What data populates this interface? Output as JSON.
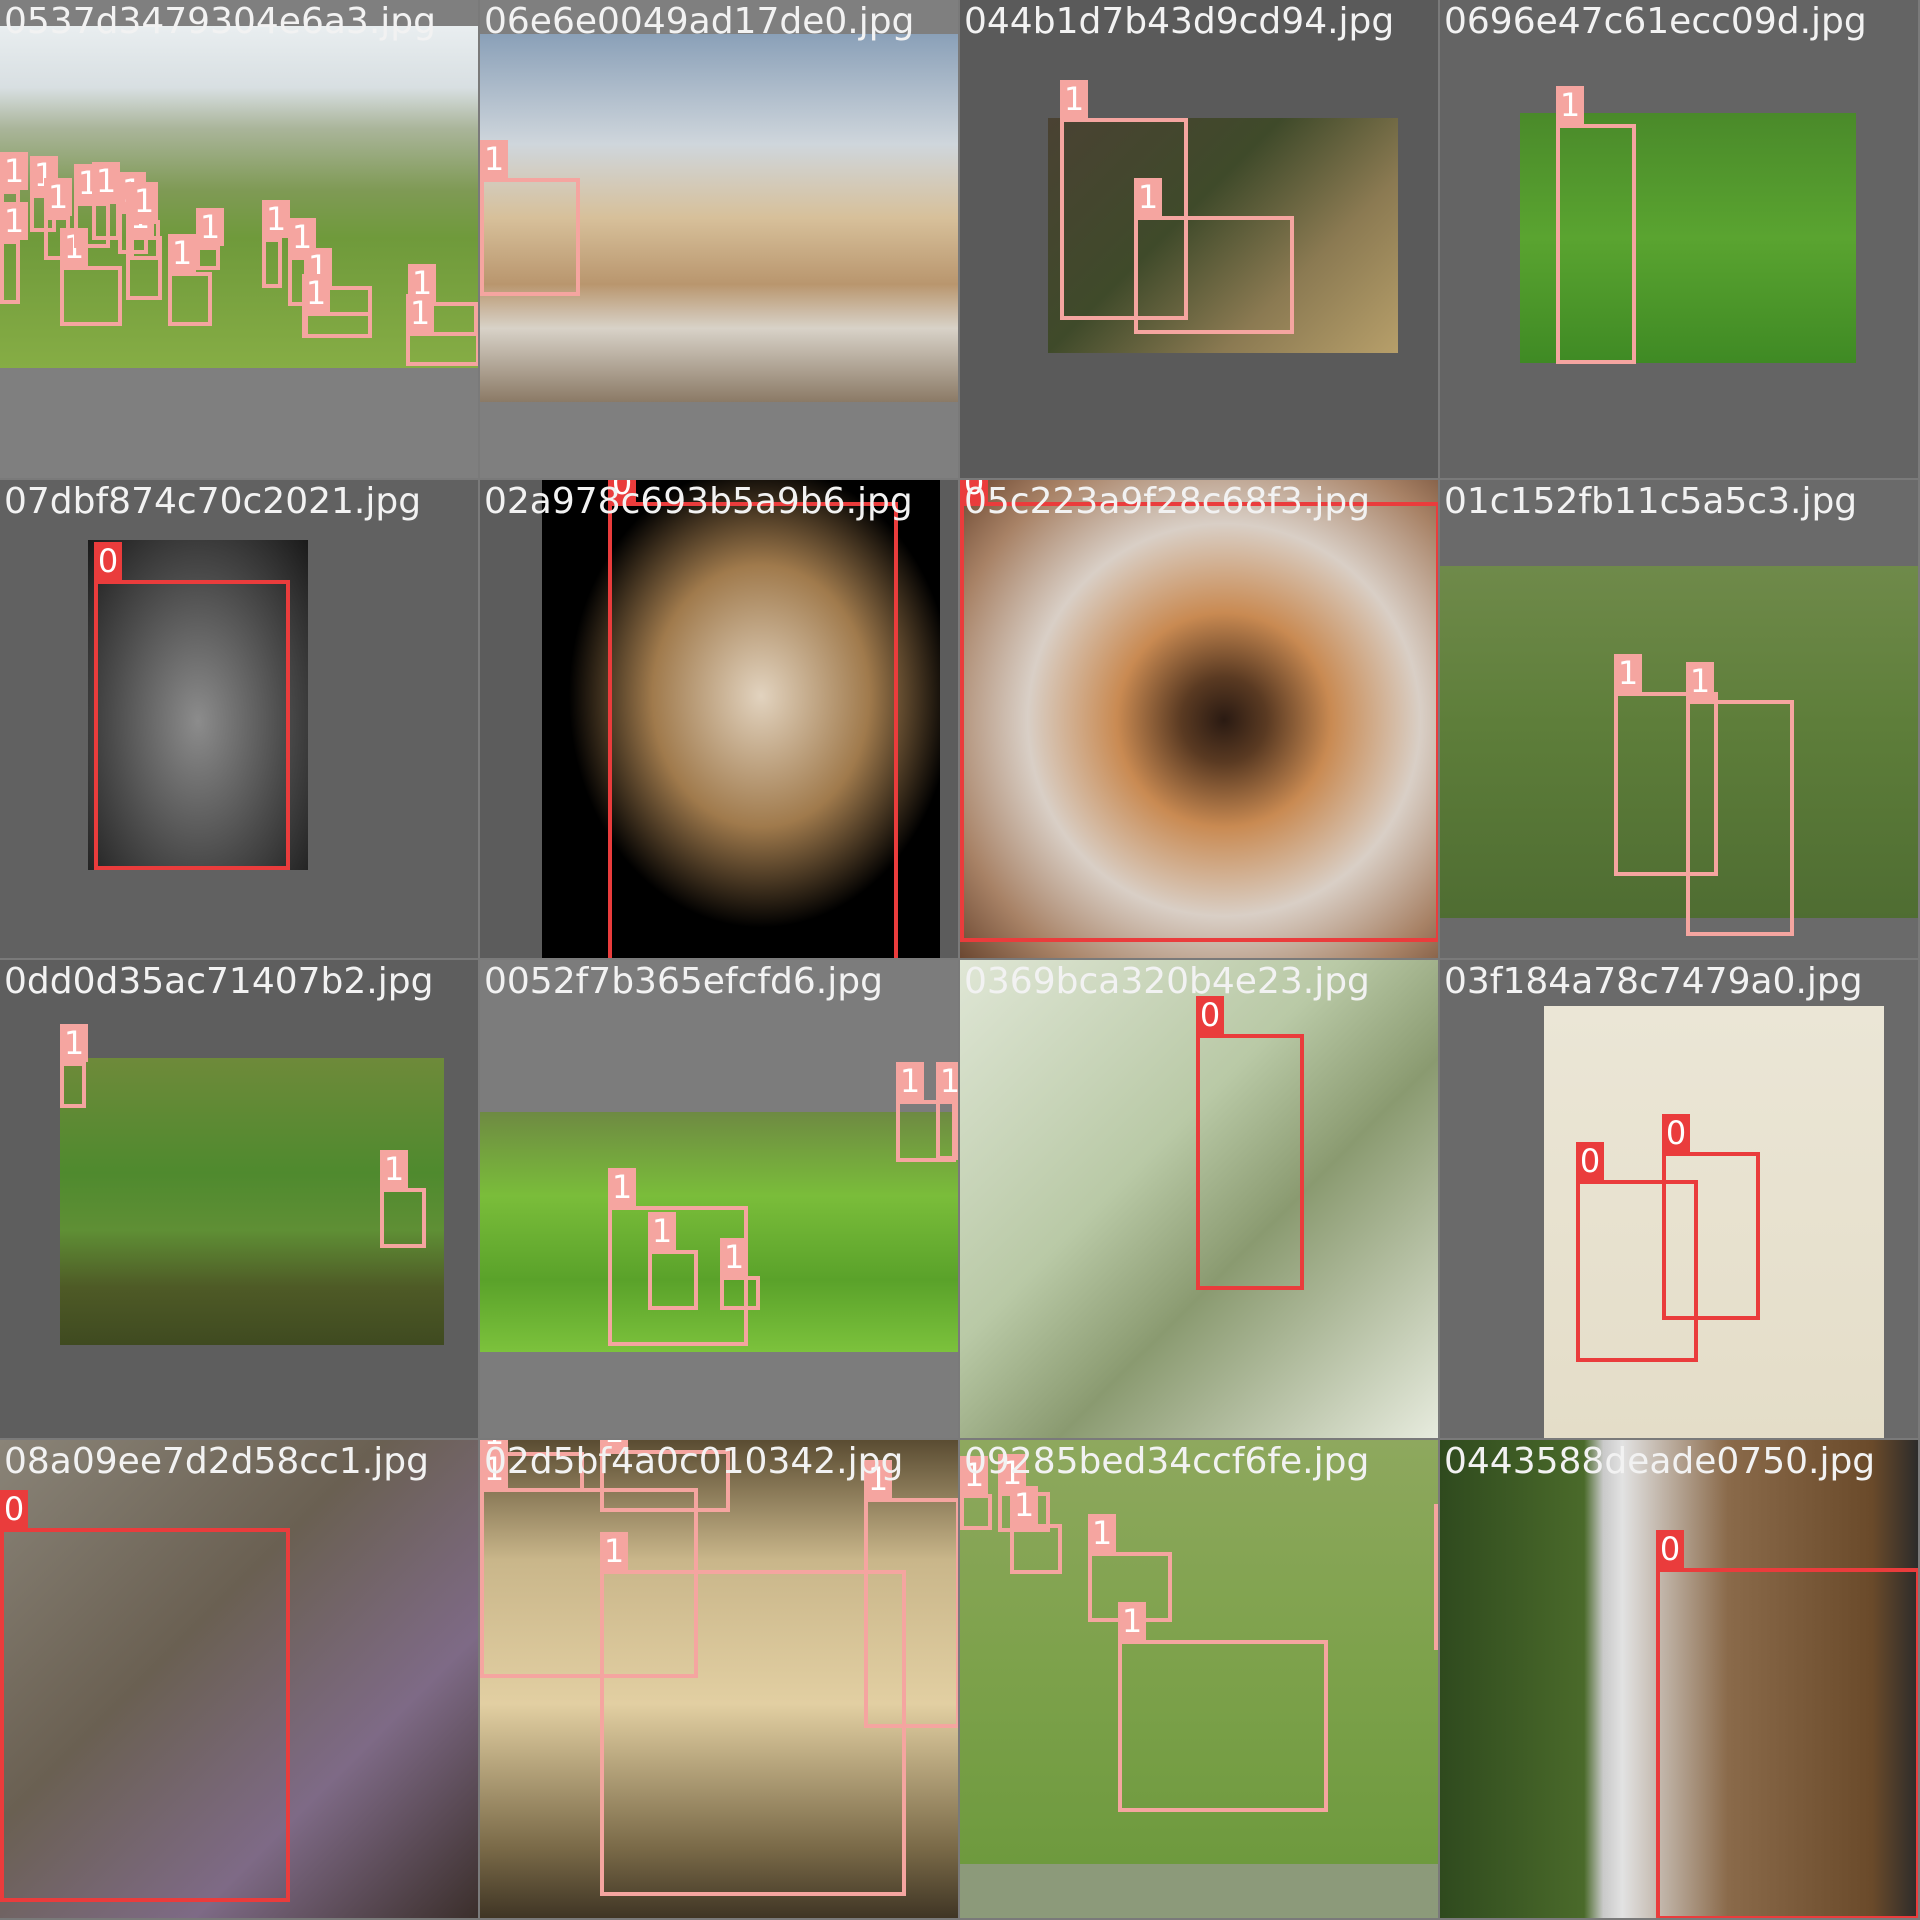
{
  "colors": {
    "class0": "#ea3c3c",
    "class1": "#f5a5a0",
    "label_text": "#f2f2f2"
  },
  "tiles": [
    {
      "filename": "0537d3479304e6a3.jpg",
      "labels": [
        "1",
        "1",
        "1",
        "1",
        "1",
        "1",
        "1",
        "1",
        "1",
        "1",
        "1",
        "1",
        "1",
        "1",
        "1",
        "1",
        "1",
        "1"
      ],
      "classes": [
        1,
        1,
        1,
        1,
        1,
        1,
        1,
        1,
        1,
        1,
        1,
        1,
        1,
        1,
        1,
        1,
        1,
        1
      ]
    },
    {
      "filename": "06e6e0049ad17de0.jpg",
      "labels": [
        "1"
      ],
      "classes": [
        1
      ]
    },
    {
      "filename": "044b1d7b43d9cd94.jpg",
      "labels": [
        "1",
        "1"
      ],
      "classes": [
        1,
        1
      ]
    },
    {
      "filename": "0696e47c61ecc09d.jpg",
      "labels": [
        "1"
      ],
      "classes": [
        1
      ]
    },
    {
      "filename": "07dbf874c70c2021.jpg",
      "labels": [
        "0"
      ],
      "classes": [
        0
      ]
    },
    {
      "filename": "02a978c693b5a9b6.jpg",
      "labels": [
        "0"
      ],
      "classes": [
        0
      ]
    },
    {
      "filename": "05c223a9f28c68f3.jpg",
      "labels": [
        "0"
      ],
      "classes": [
        0
      ]
    },
    {
      "filename": "01c152fb11c5a5c3.jpg",
      "labels": [
        "1",
        "1"
      ],
      "classes": [
        1,
        1
      ]
    },
    {
      "filename": "0dd0d35ac71407b2.jpg",
      "labels": [
        "1",
        "1"
      ],
      "classes": [
        1,
        1
      ]
    },
    {
      "filename": "0052f7b365efcfd6.jpg",
      "labels": [
        "1",
        "1",
        "1",
        "1",
        "1"
      ],
      "classes": [
        1,
        1,
        1,
        1,
        1
      ]
    },
    {
      "filename": "0369bca320b4e23.jpg",
      "labels": [
        "0"
      ],
      "classes": [
        0
      ]
    },
    {
      "filename": "03f184a78c7479a0.jpg",
      "labels": [
        "0",
        "0"
      ],
      "classes": [
        0,
        0
      ]
    },
    {
      "filename": "08a09ee7d2d58cc1.jpg",
      "labels": [
        "0"
      ],
      "classes": [
        0
      ]
    },
    {
      "filename": "02d5bf4a0c010342.jpg",
      "labels": [
        "1",
        "1",
        "1",
        "1",
        "1"
      ],
      "classes": [
        1,
        1,
        1,
        1,
        1
      ]
    },
    {
      "filename": "09285bed34ccf6fe.jpg",
      "labels": [
        "1",
        "1",
        "1",
        "1",
        "1",
        "1"
      ],
      "classes": [
        1,
        1,
        1,
        1,
        1,
        1
      ]
    },
    {
      "filename": "0443588deade0750.jpg",
      "labels": [
        "0"
      ],
      "classes": [
        0
      ]
    }
  ]
}
